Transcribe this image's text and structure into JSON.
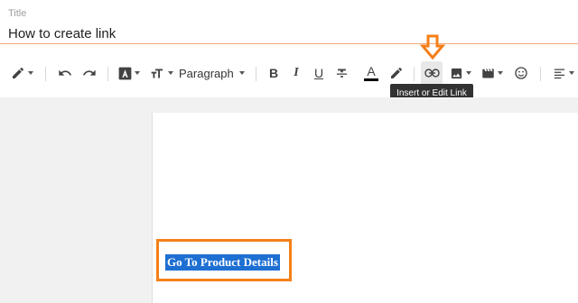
{
  "title_field": {
    "label": "Title",
    "value": "How to create link",
    "underline_color": "#f4a77a"
  },
  "toolbar": {
    "buttons": [
      {
        "name": "pencil-mode-icon",
        "has_dropdown": true
      },
      {
        "name": "undo-icon"
      },
      {
        "name": "redo-icon"
      },
      {
        "name": "font-icon",
        "has_dropdown": true
      },
      {
        "name": "text-size-icon",
        "has_dropdown": true
      },
      {
        "name": "bold-icon",
        "glyph": "B"
      },
      {
        "name": "italic-icon",
        "glyph": "I"
      },
      {
        "name": "underline-icon",
        "glyph": "U"
      },
      {
        "name": "strikethrough-icon"
      },
      {
        "name": "text-color-icon",
        "glyph": "A"
      },
      {
        "name": "highlight-color-icon"
      },
      {
        "name": "link-icon",
        "active": true
      },
      {
        "name": "image-icon",
        "has_dropdown": true
      },
      {
        "name": "video-icon",
        "has_dropdown": true
      },
      {
        "name": "emoji-icon"
      },
      {
        "name": "align-icon",
        "has_dropdown": true
      }
    ],
    "paragraph_select": "Paragraph"
  },
  "tooltip": {
    "text": "Insert or Edit Link"
  },
  "editor": {
    "selected_text": "Go To Product Details",
    "selection_color": "#1e6fd2",
    "annotation_color": "#f57f17"
  }
}
